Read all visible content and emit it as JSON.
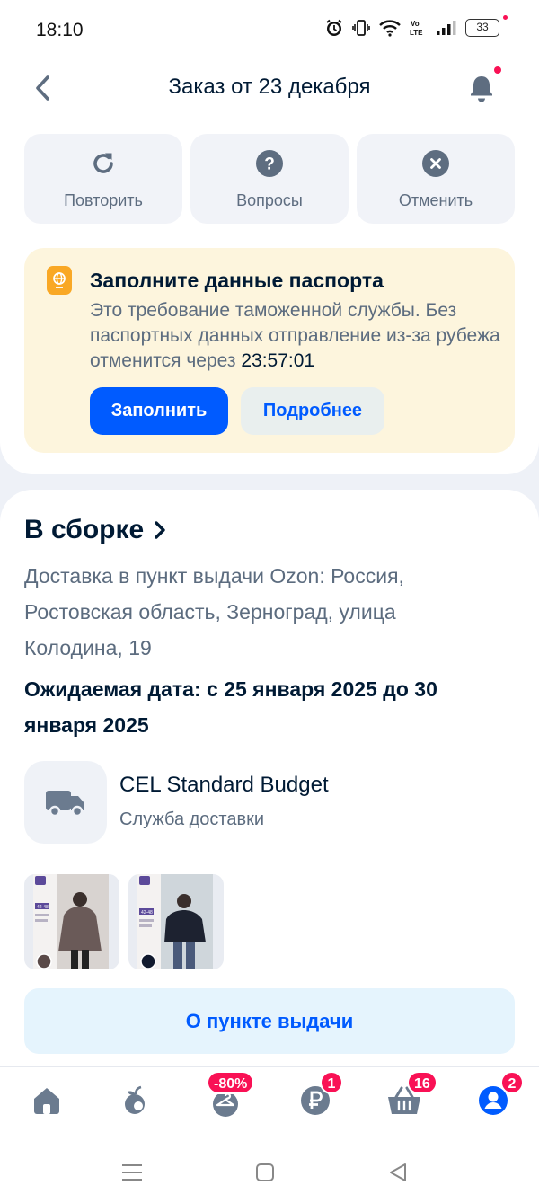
{
  "status_bar": {
    "time": "18:10",
    "battery": "33",
    "icons": [
      "alarm-icon",
      "vibrate-icon",
      "wifi-icon",
      "volte-icon",
      "signal-icon",
      "battery-icon"
    ]
  },
  "header": {
    "title": "Заказ от 23 декабря",
    "back_icon": "chevron-left-icon",
    "bell_icon": "bell-icon"
  },
  "actions": [
    {
      "label": "Повторить",
      "icon": "repeat-icon"
    },
    {
      "label": "Вопросы",
      "icon": "question-icon"
    },
    {
      "label": "Отменить",
      "icon": "cancel-icon"
    }
  ],
  "passport_notice": {
    "title": "Заполните данные паспорта",
    "text": "Это требование таможенной службы. Без паспортных данных отправление из-за рубежа отменится через",
    "timer": "23:57:01",
    "fill_button": "Заполнить",
    "more_button": "Подробнее"
  },
  "order": {
    "status": "В сборке",
    "address": "Доставка в пункт выдачи Ozon: Россия, Ростовская область, Зерноград, улица Колодина, 19",
    "expected_date": "Ожидаемая дата: с 25 января 2025 до 30 января 2025",
    "carrier_name": "CEL Standard Budget",
    "carrier_sub": "Служба доставки",
    "products": [
      {
        "alt": "product-fur-coat-1",
        "size_tag": "42-48"
      },
      {
        "alt": "product-fur-coat-2",
        "size_tag": "42-48"
      }
    ],
    "pickup_button": "О пункте выдачи"
  },
  "tabbar": {
    "tabs": [
      {
        "name": "home",
        "icon": "home-icon",
        "badge": ""
      },
      {
        "name": "fresh",
        "icon": "fruit-icon",
        "badge": ""
      },
      {
        "name": "sale",
        "icon": "hanger-icon",
        "badge": "-80%"
      },
      {
        "name": "finance",
        "icon": "ruble-icon",
        "badge": "1"
      },
      {
        "name": "cart",
        "icon": "basket-icon",
        "badge": "16"
      },
      {
        "name": "profile",
        "icon": "profile-icon",
        "badge": "2"
      }
    ],
    "accent": "#005bff",
    "badge_color": "#f91155"
  },
  "nav_bar": {
    "buttons": [
      "menu-icon",
      "home-square-icon",
      "back-triangle-icon"
    ]
  }
}
